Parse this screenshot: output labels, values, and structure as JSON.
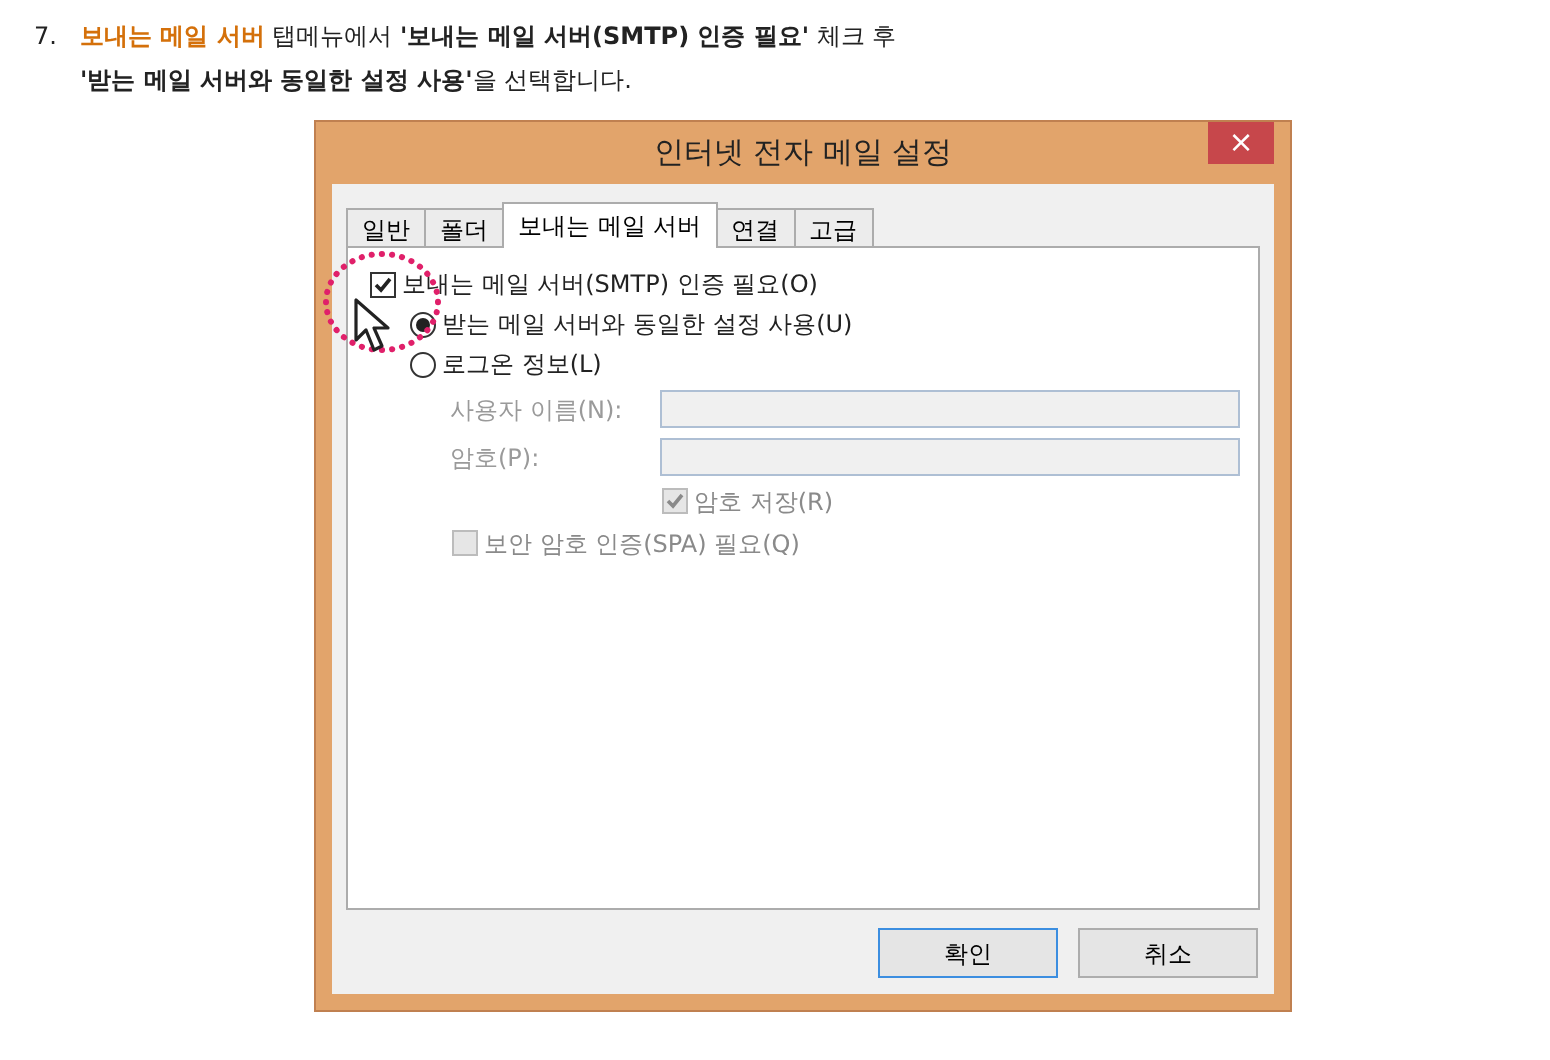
{
  "instruction": {
    "number": "7.",
    "highlight": "보내는 메일 서버",
    "text1": " 탭메뉴에서 ",
    "bold1": "'보내는 메일 서버(SMTP) 인증 필요'",
    "text2": " 체크 후",
    "bold2": "'받는 메일 서버와 동일한 설정 사용'",
    "text3": "을 선택합니다."
  },
  "window": {
    "title": "인터넷 전자 메일 설정",
    "close": "×"
  },
  "tabs": [
    {
      "label": "일반",
      "selected": false
    },
    {
      "label": "폴더",
      "selected": false
    },
    {
      "label": "보내는 메일 서버",
      "selected": true
    },
    {
      "label": "연결",
      "selected": false
    },
    {
      "label": "고급",
      "selected": false
    }
  ],
  "smtp_auth": {
    "label": "보내는 메일 서버(SMTP) 인증 필요(O)",
    "checked": true
  },
  "radios": [
    {
      "label": "받는 메일 서버와 동일한 설정 사용(U)",
      "selected": true
    },
    {
      "label": "로그온 정보(L)",
      "selected": false
    }
  ],
  "fields": [
    {
      "label": "사용자 이름(N):"
    },
    {
      "label": "암호(P):"
    }
  ],
  "save_password": {
    "label": "암호 저장(R)",
    "checked": true,
    "disabled": true
  },
  "spa": {
    "label": "보안 암호 인증(SPA) 필요(Q)",
    "checked": false,
    "disabled": true
  },
  "buttons": [
    {
      "label": "확인",
      "default": true
    },
    {
      "label": "취소",
      "default": false
    }
  ]
}
